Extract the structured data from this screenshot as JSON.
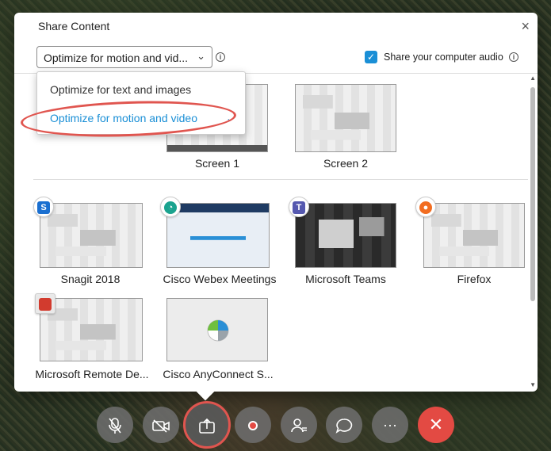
{
  "dialog": {
    "title": "Share Content",
    "close_glyph": "×",
    "optimize_select_value": "Optimize for motion and vid...",
    "audio_label": "Share your computer audio",
    "audio_checked": true
  },
  "dropdown": {
    "options": [
      "Optimize for text and images",
      "Optimize for motion and video"
    ],
    "selected": "Optimize for motion and video"
  },
  "screens": [
    {
      "label": "Screen 1"
    },
    {
      "label": "Screen 2"
    }
  ],
  "apps": [
    {
      "label": "Snagit 2018",
      "icon": "snagit-icon"
    },
    {
      "label": "Cisco Webex Meetings",
      "icon": "webex-icon"
    },
    {
      "label": "Microsoft Teams",
      "icon": "teams-icon"
    },
    {
      "label": "Firefox",
      "icon": "firefox-icon"
    },
    {
      "label": "Microsoft Remote De...",
      "icon": "remote-desktop-icon"
    },
    {
      "label": "Cisco AnyConnect S...",
      "icon": "anyconnect-icon"
    }
  ],
  "toolbar": {
    "buttons": [
      "mute-microphone",
      "stop-video",
      "share",
      "record",
      "participants",
      "chat",
      "more",
      "end-meeting"
    ],
    "more_glyph": "···",
    "end_glyph": "✕"
  },
  "colors": {
    "accent": "#1a8fd6",
    "highlight": "#e0554f",
    "end": "#e34a43"
  }
}
